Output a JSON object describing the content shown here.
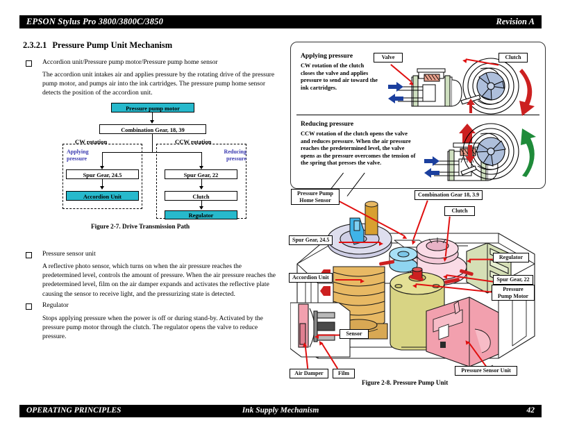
{
  "header": {
    "left": "EPSON Stylus Pro 3800/3800C/3850",
    "right": "Revision A"
  },
  "footer": {
    "left": "OPERATING PRINCIPLES",
    "center": "Ink Supply Mechanism",
    "page": "42"
  },
  "section": {
    "number": "2.3.2.1",
    "title": "Pressure Pump Unit Mechanism"
  },
  "bullets": [
    {
      "label": "Accordion unit/Pressure pump motor/Pressure pump home sensor",
      "body": "The accordion unit intakes air and applies pressure by the rotating drive of the pressure pump motor, and pumps air into the ink cartridges. The pressure pump home sensor detects the position of the accordion unit."
    },
    {
      "label": "Pressure sensor unit",
      "body": "A reflective photo sensor, which turns on when the air pressure reaches the predetermined level, controls the amount of pressure. When the air pressure reaches the predetermined level, film on the air damper expands and activates the reflective plate causing the sensor to receive light, and the pressurizing state is detected."
    },
    {
      "label": "Regulator",
      "body": "Stops applying pressure when the power is off or during stand-by. Activated by the pressure pump motor through the clutch. The regulator opens the valve to reduce pressure."
    }
  ],
  "flowchart": {
    "caption": "Figure 2-7.  Drive Transmission Path",
    "motor": "Pressure pump motor",
    "combination_gear": "Combination Gear, 18, 39",
    "cw_rotation": "CW rotation",
    "ccw_rotation": "CCW rotation",
    "applying_pressure_line1": "Applying",
    "applying_pressure_line2": "pressure",
    "reducing_pressure_line1": "Reducing",
    "reducing_pressure_line2": "pressure",
    "spur_gear_245": "Spur Gear, 24.5",
    "accordion_unit": "Accordion Unit",
    "spur_gear_22": "Spur Gear, 22",
    "clutch": "Clutch",
    "regulator": "Regulator",
    "accent_color": "#27b9cc",
    "label_color": "#3a3ab0"
  },
  "callout": {
    "applying": {
      "title": "Applying pressure",
      "body": "CW rotation of the clutch closes the valve and applies pressure to send air toward the ink cartridges.",
      "valve_label": "Valve",
      "clutch_label": "Clutch",
      "arrow_color": "#cc2020"
    },
    "reducing": {
      "title": "Reducing pressure",
      "body": "CCW rotation of the clutch opens the valve and reduces pressure. When the air pressure reaches the predetermined level, the valve opens as the pressure overcomes the tension of the spring that presses the valve.",
      "arrow_color": "#1f8b3a"
    }
  },
  "assembly": {
    "caption": "Figure 2-8.  Pressure Pump Unit",
    "labels": {
      "home_sensor_l1": "Pressure Pump",
      "home_sensor_l2": "Home Sensor",
      "combination_gear": "Combination Gear 18, 3.9",
      "clutch": "Clutch",
      "spur_gear_245": "Spur Gear, 24.5",
      "accordion_unit": "Accordion Unit",
      "regulator": "Regulator",
      "spur_gear_22": "Spur Gear, 22",
      "pump_motor_l1": "Pressure",
      "pump_motor_l2": "Pump Motor",
      "sensor": "Sensor",
      "air_damper": "Air Damper",
      "film": "Film",
      "pressure_sensor_unit": "Pressure Sensor Unit"
    }
  }
}
